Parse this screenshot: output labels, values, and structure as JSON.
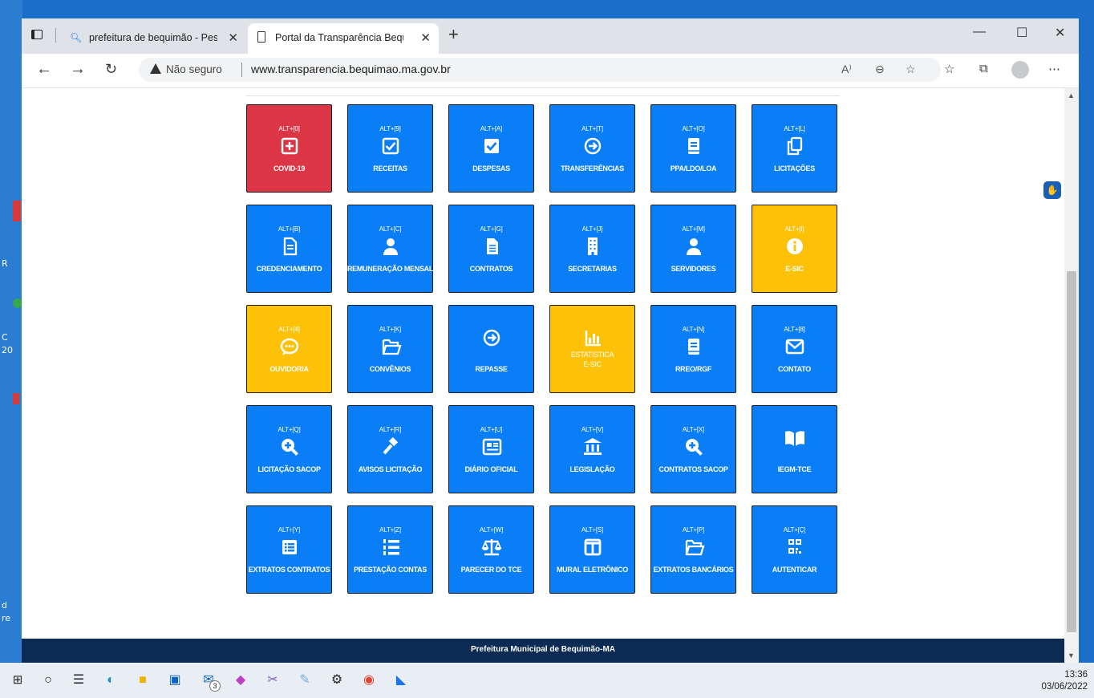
{
  "browser": {
    "tabs": [
      {
        "title": "prefeitura de bequimão - Pesqui",
        "close": "✕"
      },
      {
        "title": "Portal da Transparência Bequimã",
        "close": "✕"
      }
    ],
    "new_tab": "+",
    "window_controls": {
      "minimize": "—",
      "maximize": "☐",
      "close": "✕"
    },
    "security_label": "Não seguro",
    "url": "www.transparencia.bequimao.ma.gov.br",
    "more": "⋯"
  },
  "tiles": [
    {
      "key": "ALT+[0]",
      "label": "COVID-19",
      "icon": "plus-square-icon",
      "color": "#dc3545"
    },
    {
      "key": "ALT+[9]",
      "label": "RECEITAS",
      "icon": "check-square-icon",
      "color": "#0a7ef7"
    },
    {
      "key": "ALT+[A]",
      "label": "DESPESAS",
      "icon": "check-square-filled-icon",
      "color": "#0a7ef7"
    },
    {
      "key": "ALT+[T]",
      "label": "TRANSFERÊNCIAS",
      "icon": "arrow-circle-right-icon",
      "color": "#0a7ef7"
    },
    {
      "key": "ALT+[O]",
      "label": "PPA/LDO/LOA",
      "icon": "book-icon",
      "color": "#0a7ef7"
    },
    {
      "key": "ALT+[L]",
      "label": "LICITAÇÕES",
      "icon": "copy-icon",
      "color": "#0a7ef7"
    },
    {
      "key": "ALT+[B]",
      "label": "CREDENCIAMENTO",
      "icon": "file-text-icon",
      "color": "#0a7ef7"
    },
    {
      "key": "ALT+[C]",
      "label": "REMUNERAÇÃO MENSAL",
      "icon": "user-icon",
      "color": "#0a7ef7"
    },
    {
      "key": "ALT+[G]",
      "label": "CONTRATOS",
      "icon": "file-alt-icon",
      "color": "#0a7ef7"
    },
    {
      "key": "ALT+[J]",
      "label": "SECRETARIAS",
      "icon": "building-icon",
      "color": "#0a7ef7"
    },
    {
      "key": "ALT+[M]",
      "label": "SERVIDORES",
      "icon": "user-icon",
      "color": "#0a7ef7"
    },
    {
      "key": "ALT+[I]",
      "label": "E-SIC",
      "icon": "info-circle-icon",
      "color": "#fdc107"
    },
    {
      "key": "ALT+[4]",
      "label": "OUVIDORIA",
      "icon": "comment-dots-icon",
      "color": "#fdc107"
    },
    {
      "key": "ALT+[K]",
      "label": "CONVÊNIOS",
      "icon": "folder-open-icon",
      "color": "#0a7ef7"
    },
    {
      "key": "",
      "label": "REPASSE",
      "icon": "arrow-circle-right-icon",
      "color": "#0a7ef7"
    },
    {
      "key": "",
      "label": "ESTATISTICA\nE-SIC",
      "icon": "bar-chart-icon",
      "color": "#fdc107"
    },
    {
      "key": "ALT+[N]",
      "label": "RREO/RGF",
      "icon": "book-icon",
      "color": "#0a7ef7"
    },
    {
      "key": "ALT+[8]",
      "label": "CONTATO",
      "icon": "envelope-icon",
      "color": "#0a7ef7"
    },
    {
      "key": "ALT+[Q]",
      "label": "LICITAÇÃO SACOP",
      "icon": "search-plus-icon",
      "color": "#0a7ef7"
    },
    {
      "key": "ALT+[R]",
      "label": "AVISOS LICITAÇÃO",
      "icon": "gavel-icon",
      "color": "#0a7ef7"
    },
    {
      "key": "ALT+[U]",
      "label": "DIÁRIO OFICIAL",
      "icon": "newspaper-icon",
      "color": "#0a7ef7"
    },
    {
      "key": "ALT+[V]",
      "label": "LEGISLAÇÃO",
      "icon": "landmark-icon",
      "color": "#0a7ef7"
    },
    {
      "key": "ALT+[X]",
      "label": "CONTRATOS SACOP",
      "icon": "search-plus-icon",
      "color": "#0a7ef7"
    },
    {
      "key": "",
      "label": "IEGM-TCE",
      "icon": "book-open-icon",
      "color": "#0a7ef7"
    },
    {
      "key": "ALT+[Y]",
      "label": "EXTRATOS CONTRATOS",
      "icon": "list-alt-icon",
      "color": "#0a7ef7"
    },
    {
      "key": "ALT+[Z]",
      "label": "PRESTAÇÃO CONTAS",
      "icon": "list-ol-icon",
      "color": "#0a7ef7"
    },
    {
      "key": "ALT+[W]",
      "label": "PARECER DO TCE",
      "icon": "balance-scale-icon",
      "color": "#0a7ef7"
    },
    {
      "key": "ALT+[S]",
      "label": "MURAL ELETRÔNICO",
      "icon": "columns-icon",
      "color": "#0a7ef7"
    },
    {
      "key": "ALT+[P]",
      "label": "EXTRATOS BANCÁRIOS",
      "icon": "folder-open-icon",
      "color": "#0a7ef7"
    },
    {
      "key": "ALT+[Ç]",
      "label": "AUTENTICAR",
      "icon": "qrcode-icon",
      "color": "#0a7ef7"
    }
  ],
  "footer": {
    "text": "Prefeitura Municipal de Bequimão-MA"
  },
  "taskbar": {
    "time": "13:36",
    "date": "03/06/2022",
    "badge": "3"
  }
}
